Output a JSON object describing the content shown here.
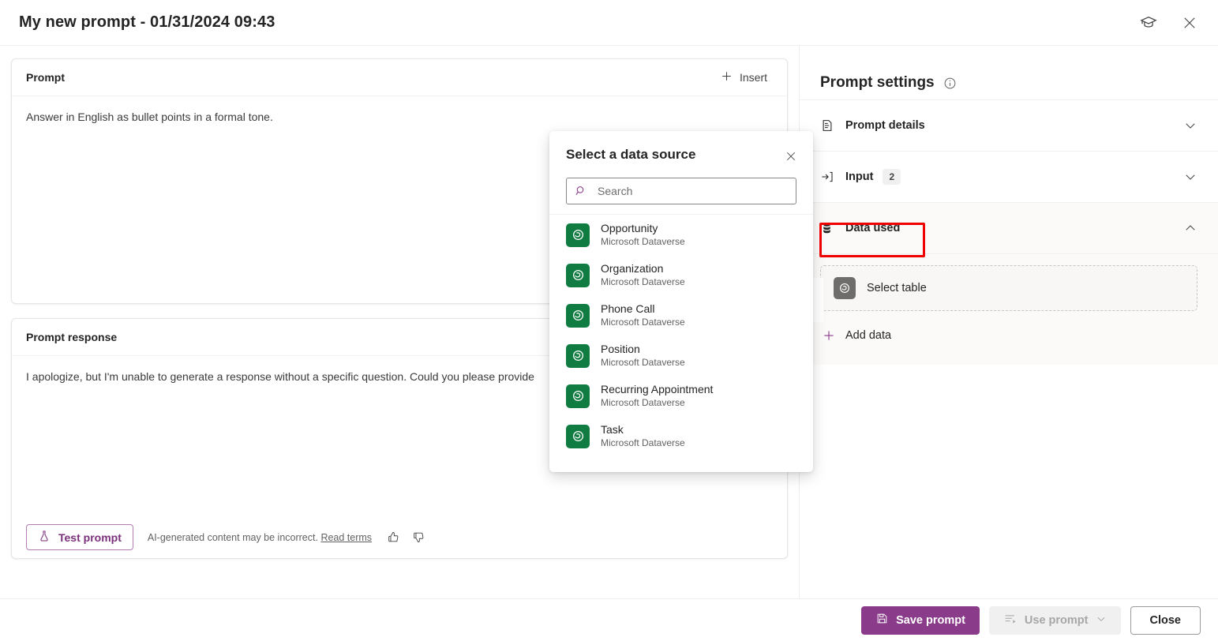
{
  "window": {
    "title": "My new prompt - 01/31/2024 09:43",
    "learn_icon": "graduation-cap-icon",
    "close_icon": "close-icon"
  },
  "prompt_card": {
    "label": "Prompt",
    "insert_label": "Insert",
    "text": "Answer in English as bullet points in a formal tone."
  },
  "response_card": {
    "label": "Prompt response",
    "text": "I apologize, but I'm unable to generate a response without a specific question. Could you please provide",
    "test_button": "Test prompt",
    "disclaimer": "AI-generated content may be incorrect.",
    "read_terms": "Read terms",
    "thumb_up_icon": "thumbs-up-icon",
    "thumb_down_icon": "thumbs-down-icon"
  },
  "flyout": {
    "title": "Select a data source",
    "close_icon": "close-icon",
    "search": {
      "placeholder": "Search",
      "value": "",
      "icon": "search-icon"
    },
    "items": [
      {
        "name": "Opportunity",
        "source": "Microsoft Dataverse",
        "icon": "dataverse-icon"
      },
      {
        "name": "Organization",
        "source": "Microsoft Dataverse",
        "icon": "dataverse-icon"
      },
      {
        "name": "Phone Call",
        "source": "Microsoft Dataverse",
        "icon": "dataverse-icon"
      },
      {
        "name": "Position",
        "source": "Microsoft Dataverse",
        "icon": "dataverse-icon"
      },
      {
        "name": "Recurring Appointment",
        "source": "Microsoft Dataverse",
        "icon": "dataverse-icon"
      },
      {
        "name": "Task",
        "source": "Microsoft Dataverse",
        "icon": "dataverse-icon"
      }
    ]
  },
  "settings": {
    "title": "Prompt settings",
    "info_icon": "info-icon",
    "sections": [
      {
        "label": "Prompt details",
        "icon": "document-icon",
        "badge": "",
        "expanded": false,
        "chevron": "chevron-down-icon"
      },
      {
        "label": "Input",
        "icon": "input-arrow-icon",
        "badge": "2",
        "expanded": false,
        "chevron": "chevron-down-icon"
      },
      {
        "label": "Data used",
        "icon": "database-icon",
        "badge": "",
        "expanded": true,
        "chevron": "chevron-up-icon"
      }
    ],
    "data_used": {
      "select_table_label": "Select table",
      "select_table_icon": "dataverse-icon",
      "add_data_label": "Add data",
      "add_data_icon": "plus-icon"
    }
  },
  "footer": {
    "save_label": "Save prompt",
    "save_icon": "save-icon",
    "use_label": "Use prompt",
    "use_icon": "use-prompt-icon",
    "use_chevron": "chevron-down-icon",
    "close_label": "Close"
  },
  "colors": {
    "accent_purple": "#8a3b8a",
    "dataverse_green": "#107c41",
    "highlight_red": "#ee0000",
    "disabled_gray": "#a6a6a6"
  }
}
